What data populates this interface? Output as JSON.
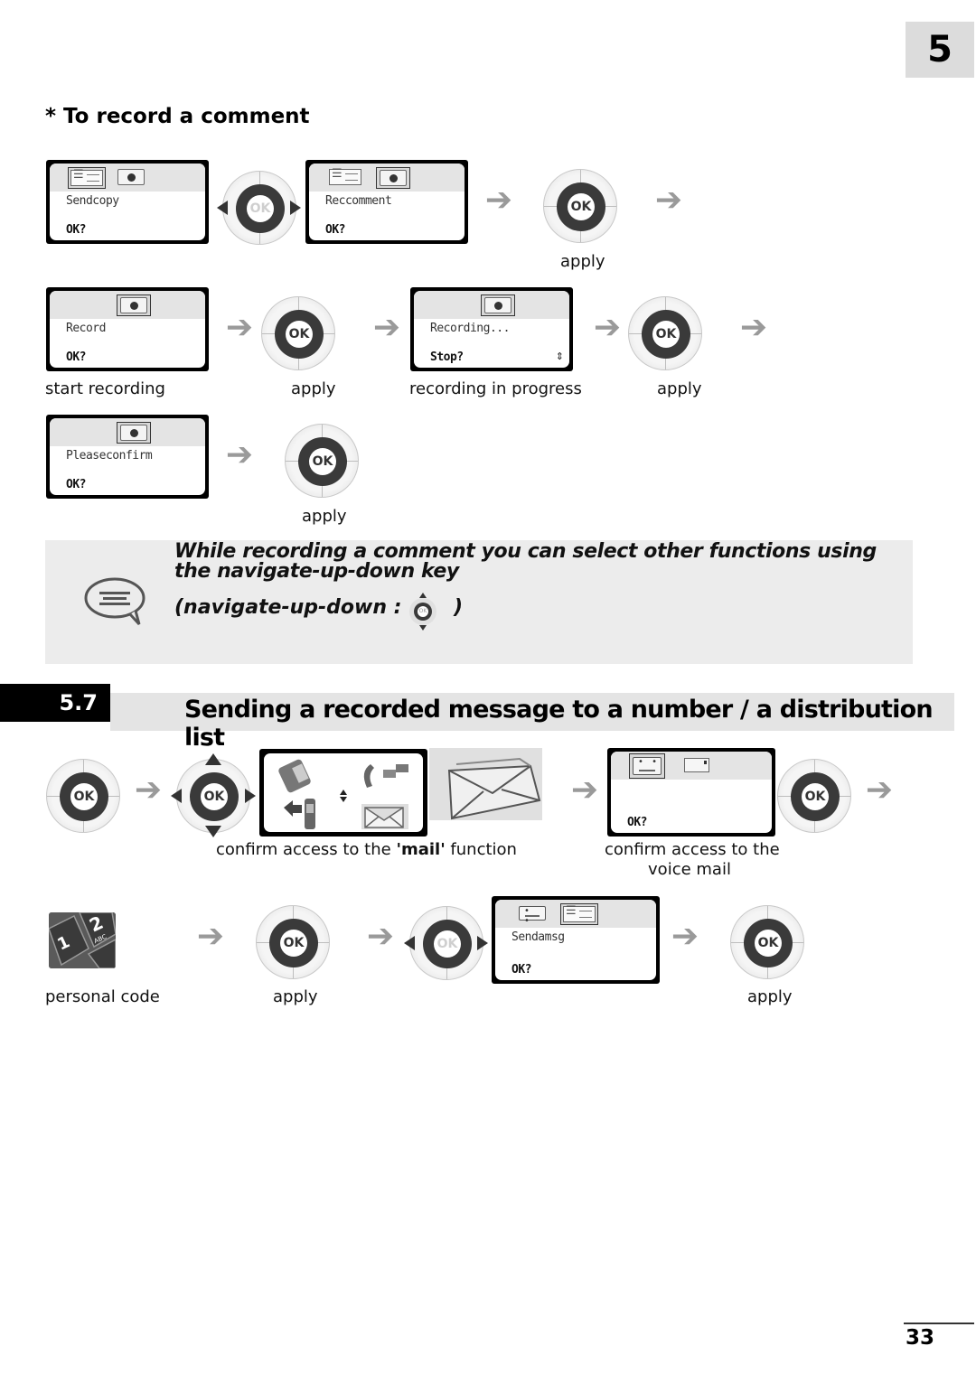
{
  "chapter_number": "5",
  "subsection_title": "* To record a comment",
  "screens": {
    "sendcopy": {
      "line1": "Sendcopy",
      "line2": "OK?"
    },
    "reccomment": {
      "line1": "Reccomment",
      "line2": "OK?"
    },
    "record": {
      "line1": "Record",
      "line2": "OK?"
    },
    "recording": {
      "line1": "Recording...",
      "line2": "Stop?",
      "scroll_glyph": "⇕"
    },
    "pleaseconfirm": {
      "line1": "Pleaseconfirm",
      "line2": "OK?"
    },
    "voicemail": {
      "line1": "",
      "line2": "OK?"
    },
    "sendamsg": {
      "line1": "Sendamsg",
      "line2": "OK?"
    }
  },
  "ok_key_label": "OK",
  "arrow_glyph": "➔",
  "captions": {
    "apply": "apply",
    "start_recording": "start recording",
    "recording_in_progress": "recording in progress",
    "confirm_mail_prefix": "confirm access to the ",
    "confirm_mail_bold": "'mail'",
    "confirm_mail_suffix": " function",
    "confirm_voicemail_line1": "confirm access to the",
    "confirm_voicemail_line2": "voice mail",
    "personal_code": "personal code"
  },
  "note": {
    "text": "While recording a comment you can select other functions using the navigate-up-down key",
    "key_prefix": "(navigate-up-down :",
    "key_suffix": ")",
    "icon": "speech-bubble-icon"
  },
  "section": {
    "number": "5.7",
    "title": "Sending a recorded message to a number / a distribution list"
  },
  "keypad": {
    "key1": "1",
    "key2": "2",
    "key2_letters": "ABC"
  },
  "page_number": "33"
}
